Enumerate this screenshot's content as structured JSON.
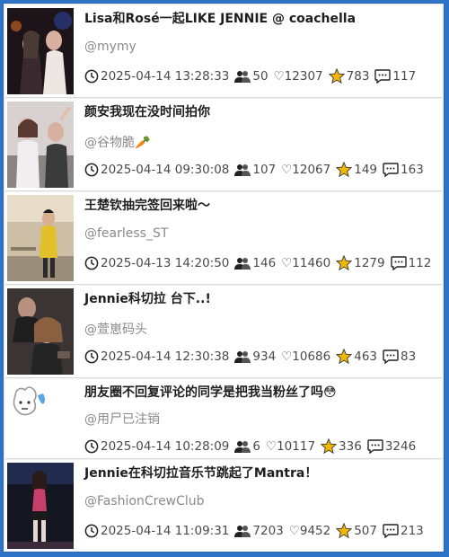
{
  "posts": [
    {
      "title": "Lisa和Rosé一起LIKE JENNIE @ coachella",
      "author": "@mymy",
      "time": "2025-04-14 13:28:33",
      "users": "50",
      "likes": "♡12307",
      "stars": "783",
      "comments": "117",
      "thumb": {
        "bg": "#1c1418",
        "accent": "#6a4a52"
      }
    },
    {
      "title": "颜安我现在没时间拍你",
      "author": "@谷物脆🥕",
      "time": "2025-04-14 09:30:08",
      "users": "107",
      "likes": "♡12067",
      "stars": "149",
      "comments": "163",
      "thumb": {
        "bg": "#d7d2cf",
        "accent": "#a38f86"
      }
    },
    {
      "title": "王楚钦抽完签回来啦～",
      "author": "@fearless_ST",
      "time": "2025-04-13 14:20:50",
      "users": "146",
      "likes": "♡11460",
      "stars": "1279",
      "comments": "112",
      "thumb": {
        "bg": "#cdbfa6",
        "accent": "#e2c02a"
      }
    },
    {
      "title": "Jennie科切拉 台下..!",
      "author": "@萱崽码头",
      "time": "2025-04-14 12:30:38",
      "users": "934",
      "likes": "♡10686",
      "stars": "463",
      "comments": "83",
      "thumb": {
        "bg": "#3a3434",
        "accent": "#8a7060"
      }
    },
    {
      "title": "朋友圈不回复评论的同学是把我当粉丝了吗😳",
      "author": "@用尸已注销",
      "time": "2025-04-14 10:28:09",
      "users": "6",
      "likes": "♡10117",
      "stars": "336",
      "comments": "3246",
      "thumb": {
        "bg": "#ffffff",
        "accent": "#9a9a9a"
      }
    },
    {
      "title": "Jennie在科切拉音乐节跳起了Mantra！",
      "author": "@FashionCrewClub",
      "time": "2025-04-14 11:09:31",
      "users": "7203",
      "likes": "♡9452",
      "stars": "507",
      "comments": "213",
      "thumb": {
        "bg": "#141622",
        "accent": "#c8406a"
      }
    }
  ],
  "colors": {
    "frame": "#2f73c6",
    "star": "#f2b705",
    "icon": "#222222"
  },
  "icons": [
    "clock-icon",
    "users-icon",
    "heart-icon",
    "star-icon",
    "comment-icon"
  ]
}
